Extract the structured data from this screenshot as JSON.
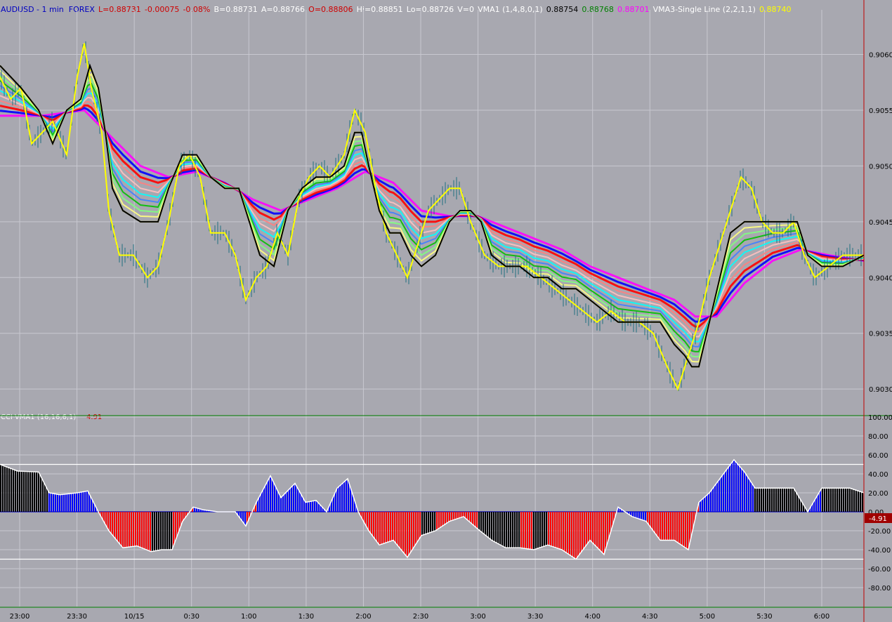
{
  "header": {
    "symbol": "AUDUSD - 1 min  FOREX",
    "last": "L=0.88731",
    "change": "-0.00075",
    "change_pct": "-0.08%",
    "bid": "B=0.88731",
    "ask": "A=0.88766",
    "open": "O=0.88806",
    "high": "Hi=0.88851",
    "low": "Lo=0.88726",
    "volume": "V=0",
    "vma1_label": "VMA1 (1,4,8,0,1)",
    "vma1_v1": "0.88754",
    "vma1_v2": "0.88768",
    "vma1_v3": "0.88701",
    "vma3_label": "VMA3-Single Line (2,2,1,1)",
    "vma3_value": "0.88740"
  },
  "indicator": {
    "label": "CCI-VMA1 (16,16,6,1)",
    "value": "-4.91",
    "marker": "-4.91"
  },
  "colors": {
    "background": "#a8a8b0",
    "grid": "#c8c8d0",
    "price_line": "#ffff00",
    "vma_line": "#000000",
    "cci_up": "#0000ff",
    "cci_down": "#ff0000",
    "cci_neutral": "#000000"
  },
  "chart_data": [
    {
      "type": "line",
      "panel": "price",
      "y_ticks": [
        "0.9060",
        "0.9055",
        "0.9050",
        "0.9045",
        "0.9040",
        "0.9035",
        "0.9030"
      ],
      "ylim": [
        0.90285,
        0.9064
      ],
      "x_ticks": [
        "23:00",
        "23:30",
        "10/15",
        "0:30",
        "1:00",
        "1:30",
        "2:00",
        "2:30",
        "3:00",
        "3:30",
        "4:00",
        "4:30",
        "5:00",
        "5:30",
        "6:00"
      ],
      "series": [
        {
          "role": "price",
          "x": [
            0,
            15,
            30,
            45,
            60,
            75,
            95,
            110,
            120,
            130,
            145,
            155,
            170,
            190,
            210,
            225,
            240,
            255,
            270,
            285,
            300,
            320,
            335,
            350,
            365,
            380,
            395,
            410,
            425,
            440,
            455,
            470,
            490,
            505,
            520,
            535,
            550,
            565,
            580,
            595,
            610,
            625,
            640,
            655,
            670,
            690,
            710,
            730,
            750,
            770,
            790,
            810,
            830,
            850,
            870,
            890,
            910,
            930,
            950,
            965,
            980,
            995,
            1010,
            1025,
            1040,
            1055,
            1070,
            1085,
            1100,
            1115,
            1130,
            1145,
            1160,
            1180,
            1200,
            1215,
            1230
          ],
          "y": [
            0.9058,
            0.9056,
            0.9057,
            0.9052,
            0.9053,
            0.9054,
            0.9051,
            0.9058,
            0.9061,
            0.9057,
            0.9053,
            0.9046,
            0.9042,
            0.9042,
            0.904,
            0.9041,
            0.9045,
            0.905,
            0.9051,
            0.9049,
            0.9044,
            0.9044,
            0.9042,
            0.9038,
            0.904,
            0.9041,
            0.9044,
            0.9042,
            0.9047,
            0.9049,
            0.905,
            0.9049,
            0.9051,
            0.9055,
            0.9053,
            0.9048,
            0.9044,
            0.9042,
            0.904,
            0.9043,
            0.9046,
            0.9047,
            0.9048,
            0.9048,
            0.9045,
            0.9042,
            0.9041,
            0.9041,
            0.9041,
            0.904,
            0.9039,
            0.9038,
            0.9037,
            0.9036,
            0.9037,
            0.9036,
            0.9036,
            0.9035,
            0.9032,
            0.903,
            0.9033,
            0.9036,
            0.904,
            0.9043,
            0.9046,
            0.9049,
            0.9048,
            0.9045,
            0.9044,
            0.9044,
            0.9045,
            0.9042,
            0.904,
            0.9041,
            0.9042,
            0.9042,
            0.9042
          ]
        },
        {
          "role": "vma",
          "x": [
            0,
            30,
            55,
            75,
            95,
            115,
            128,
            140,
            150,
            160,
            175,
            200,
            225,
            240,
            260,
            280,
            300,
            320,
            340,
            355,
            370,
            390,
            410,
            430,
            450,
            470,
            490,
            505,
            515,
            525,
            540,
            555,
            570,
            585,
            600,
            620,
            640,
            655,
            670,
            685,
            700,
            720,
            740,
            760,
            780,
            800,
            820,
            840,
            860,
            880,
            900,
            920,
            940,
            960,
            975,
            985,
            995,
            1010,
            1025,
            1040,
            1060,
            1080,
            1100,
            1120,
            1135,
            1150,
            1170,
            1200,
            1230
          ],
          "y": [
            0.9059,
            0.9057,
            0.9055,
            0.9052,
            0.9055,
            0.9056,
            0.9059,
            0.9057,
            0.9053,
            0.9048,
            0.9046,
            0.9045,
            0.9045,
            0.9048,
            0.9051,
            0.9051,
            0.9049,
            0.9048,
            0.9048,
            0.9045,
            0.9042,
            0.9041,
            0.9046,
            0.9048,
            0.9049,
            0.9049,
            0.905,
            0.9053,
            0.9053,
            0.905,
            0.9046,
            0.9044,
            0.9044,
            0.9042,
            0.9041,
            0.9042,
            0.9045,
            0.9046,
            0.9046,
            0.9045,
            0.9042,
            0.9041,
            0.9041,
            0.904,
            0.904,
            0.9039,
            0.9039,
            0.9038,
            0.9037,
            0.9036,
            0.9036,
            0.9036,
            0.9036,
            0.9034,
            0.9033,
            0.9032,
            0.9032,
            0.9036,
            0.904,
            0.9044,
            0.9045,
            0.9045,
            0.9045,
            0.9045,
            0.9045,
            0.9042,
            0.9041,
            0.9041,
            0.9042
          ]
        },
        {
          "role": "band_top",
          "x": [
            0,
            60,
            120,
            160,
            200,
            240,
            280,
            320,
            360,
            400,
            440,
            480,
            520,
            560,
            600,
            640,
            680,
            720,
            760,
            800,
            840,
            880,
            920,
            960,
            990,
            1020,
            1060,
            1100,
            1140,
            1180,
            1230
          ],
          "y": [
            0.9058,
            0.9056,
            0.9056,
            0.9053,
            0.9051,
            0.905,
            0.905,
            0.9049,
            0.9048,
            0.9047,
            0.9048,
            0.9049,
            0.905,
            0.9049,
            0.9047,
            0.9046,
            0.9046,
            0.9045,
            0.9044,
            0.9043,
            0.9042,
            0.9041,
            0.904,
            0.9039,
            0.9038,
            0.9038,
            0.9041,
            0.9043,
            0.9044,
            0.9043,
            0.9042
          ]
        },
        {
          "role": "band_bottom",
          "x": [
            0,
            60,
            120,
            160,
            200,
            240,
            280,
            320,
            360,
            400,
            440,
            480,
            520,
            560,
            600,
            640,
            680,
            720,
            760,
            800,
            840,
            880,
            920,
            960,
            990,
            1020,
            1060,
            1100,
            1140,
            1180,
            1230
          ],
          "y": [
            0.9051,
            0.9053,
            0.9054,
            0.9052,
            0.9049,
            0.9048,
            0.9049,
            0.9048,
            0.9046,
            0.9045,
            0.9046,
            0.9047,
            0.9049,
            0.9048,
            0.9045,
            0.9045,
            0.9045,
            0.9044,
            0.9043,
            0.9042,
            0.904,
            0.9039,
            0.9038,
            0.9037,
            0.9035,
            0.9035,
            0.9038,
            0.904,
            0.9041,
            0.9041,
            0.9041
          ]
        }
      ]
    },
    {
      "type": "bar",
      "panel": "indicator",
      "y_ticks": [
        "100.00",
        "80.00",
        "60.00",
        "40.00",
        "20.00",
        "0.00",
        "-20.00",
        "-40.00",
        "-60.00",
        "-80.00"
      ],
      "ylim": [
        -100,
        100
      ],
      "levels": [
        50,
        0,
        -50
      ],
      "x": [
        0,
        25,
        55,
        70,
        85,
        110,
        125,
        140,
        155,
        175,
        195,
        215,
        230,
        245,
        260,
        275,
        290,
        310,
        335,
        350,
        365,
        385,
        400,
        420,
        435,
        450,
        465,
        480,
        495,
        510,
        525,
        540,
        560,
        580,
        600,
        620,
        640,
        660,
        680,
        700,
        720,
        740,
        760,
        780,
        800,
        820,
        840,
        860,
        880,
        900,
        920,
        940,
        960,
        980,
        995,
        1010,
        1025,
        1045,
        1060,
        1075,
        1090,
        1110,
        1130,
        1150,
        1170,
        1190,
        1210,
        1230
      ],
      "values": [
        50,
        43,
        42,
        20,
        18,
        20,
        22,
        0,
        -20,
        -38,
        -36,
        -42,
        -40,
        -40,
        -10,
        5,
        2,
        0,
        0,
        -15,
        10,
        38,
        15,
        30,
        10,
        12,
        0,
        25,
        35,
        0,
        -20,
        -35,
        -30,
        -48,
        -25,
        -20,
        -10,
        -5,
        -18,
        -30,
        -38,
        -38,
        -40,
        -35,
        -40,
        -50,
        -30,
        -45,
        5,
        -5,
        -10,
        -30,
        -30,
        -40,
        10,
        20,
        35,
        55,
        42,
        25,
        25,
        25,
        25,
        0,
        25,
        25,
        25,
        20
      ],
      "states": [
        "neutral",
        "neutral",
        "neutral",
        "up",
        "up",
        "up",
        "up",
        "down",
        "down",
        "down",
        "down",
        "neutral",
        "neutral",
        "down",
        "down",
        "up",
        "up",
        "up",
        "up",
        "down",
        "up",
        "up",
        "up",
        "up",
        "up",
        "up",
        "up",
        "up",
        "up",
        "down",
        "down",
        "down",
        "down",
        "down",
        "neutral",
        "down",
        "down",
        "down",
        "neutral",
        "neutral",
        "neutral",
        "down",
        "neutral",
        "down",
        "down",
        "down",
        "down",
        "down",
        "up",
        "up",
        "down",
        "down",
        "down",
        "down",
        "up",
        "up",
        "up",
        "up",
        "up",
        "neutral",
        "neutral",
        "neutral",
        "neutral",
        "up",
        "neutral",
        "neutral",
        "neutral",
        "up"
      ]
    }
  ]
}
